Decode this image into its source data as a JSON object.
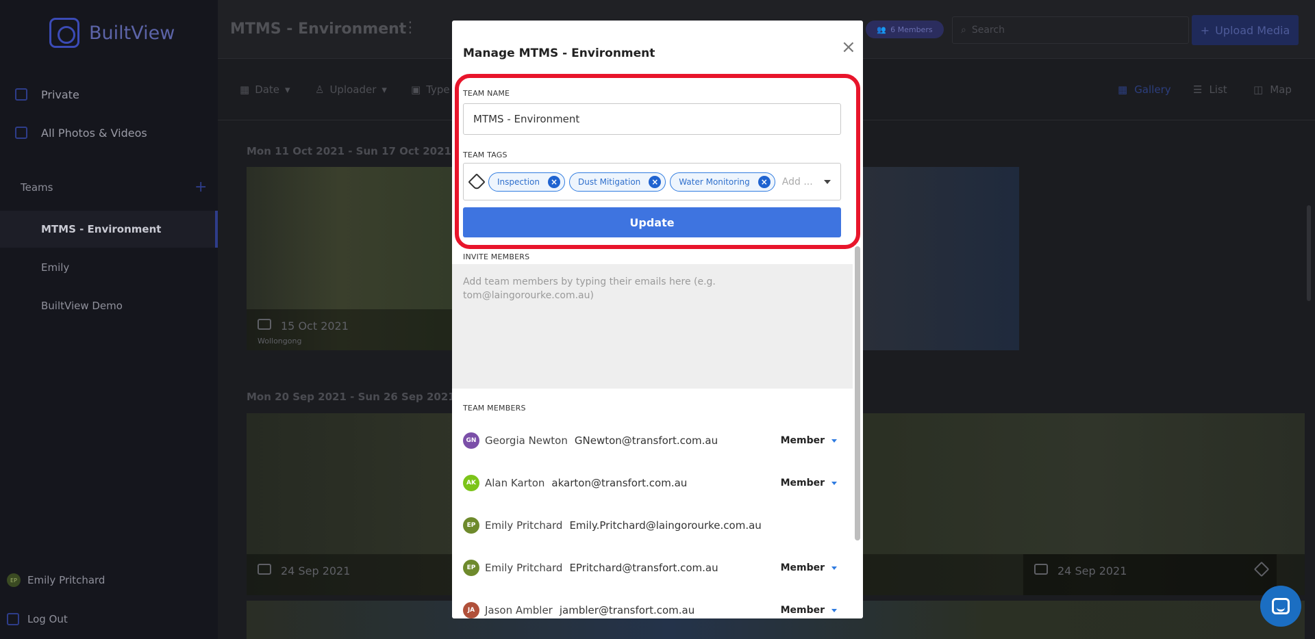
{
  "app": {
    "name": "BuiltView"
  },
  "sidebar": {
    "items": [
      {
        "label": "Private",
        "icon": "user-square-icon"
      },
      {
        "label": "All Photos & Videos",
        "icon": "gallery-icon"
      }
    ],
    "teams_heading": "Teams",
    "teams_add": "+",
    "teams": [
      {
        "label": "MTMS - Environment",
        "active": true
      },
      {
        "label": "Emily",
        "active": false
      },
      {
        "label": "BuiltView Demo",
        "active": false
      }
    ],
    "user": {
      "initials": "EP",
      "name": "Emily Pritchard"
    },
    "logout_label": "Log Out"
  },
  "header": {
    "title": "MTMS - Environment",
    "kebab": "⋮",
    "members_badge": "6 Members",
    "search_placeholder": "Search",
    "upload_label": "Upload Media",
    "upload_plus": "+"
  },
  "filters": {
    "date": "Date",
    "uploader": "Uploader",
    "type": "Type",
    "views": [
      "Gallery",
      "List",
      "Map"
    ]
  },
  "gallery": {
    "weeks": [
      {
        "label": "Mon 11 Oct 2021 - Sun 17 Oct 2021"
      },
      {
        "label": "Mon 20 Sep 2021 - Sun 26 Sep 2021"
      }
    ],
    "photos": [
      {
        "date": "15 Oct 2021",
        "location": "Wollongong"
      },
      {
        "date": "24 Sep 2021",
        "location": ""
      },
      {
        "date": "24 Sep 2021",
        "location": ""
      }
    ]
  },
  "modal": {
    "title": "Manage MTMS - Environment",
    "close": "×",
    "team_name_label": "TEAM NAME",
    "team_name_value": "MTMS - Environment",
    "team_tags_label": "TEAM TAGS",
    "tags": [
      "Inspection",
      "Dust Mitigation",
      "Water Monitoring"
    ],
    "tag_remove": "×",
    "tags_placeholder": "Add ...",
    "update_label": "Update",
    "invite_label": "INVITE MEMBERS",
    "invite_placeholder": "Add team members by typing their emails here (e.g. tom@laingorourke.com.au)",
    "members_label": "TEAM MEMBERS",
    "members": [
      {
        "initials": "GN",
        "name": "Georgia Newton",
        "email": "GNewton@transfort.com.au",
        "role": "Member",
        "color": "#7b4fa8"
      },
      {
        "initials": "AK",
        "name": "Alan Karton",
        "email": "akarton@transfort.com.au",
        "role": "Member",
        "color": "#7cc41a"
      },
      {
        "initials": "EP",
        "name": "Emily Pritchard",
        "email": "Emily.Pritchard@laingorourke.com.au",
        "role": "",
        "color": "#6e8a2c"
      },
      {
        "initials": "EP",
        "name": "Emily Pritchard",
        "email": "EPritchard@transfort.com.au",
        "role": "Member",
        "color": "#6e8a2c"
      },
      {
        "initials": "JA",
        "name": "Jason Ambler",
        "email": "jambler@transfort.com.au",
        "role": "Member",
        "color": "#b0503a"
      }
    ]
  },
  "colors": {
    "accent": "#3e74e0",
    "highlight": "#e8152b",
    "chip_border": "#2f7be0"
  }
}
